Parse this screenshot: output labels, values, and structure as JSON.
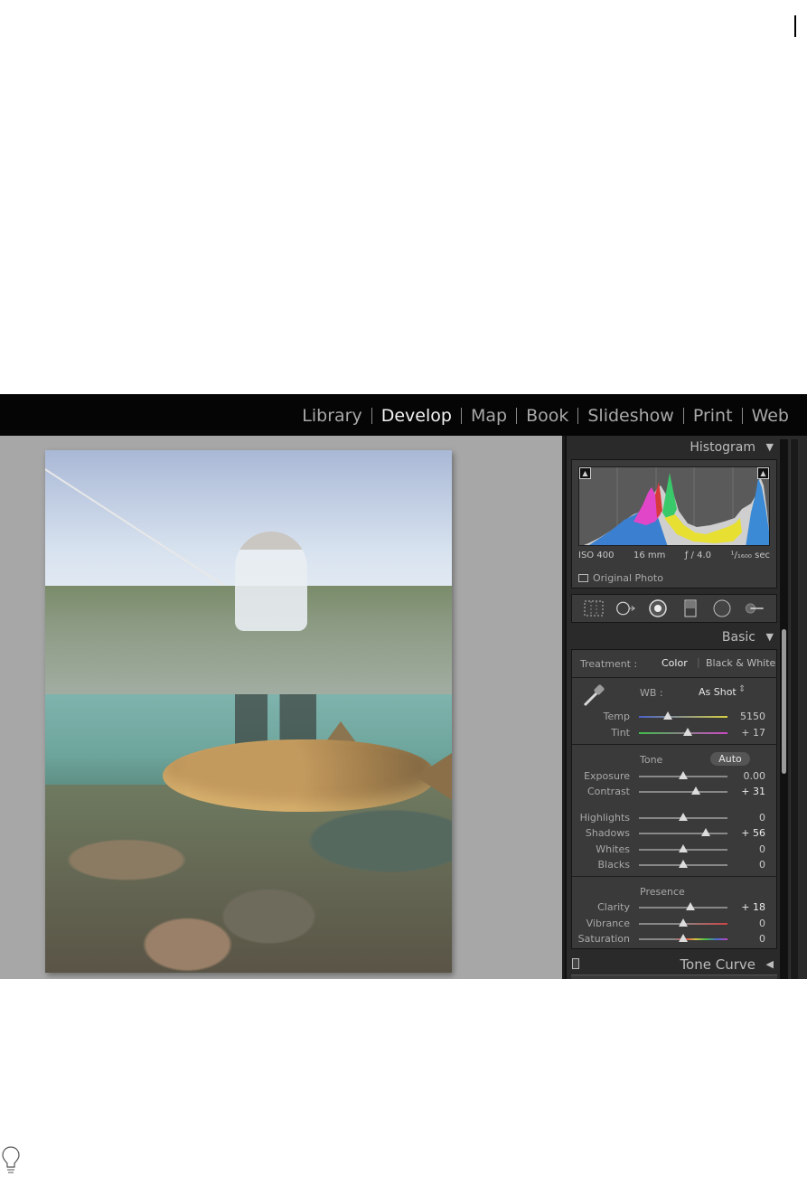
{
  "modules": [
    "Library",
    "Develop",
    "Map",
    "Book",
    "Slideshow",
    "Print",
    "Web"
  ],
  "active_module": "Develop",
  "histogram": {
    "title": "Histogram",
    "exif": {
      "iso": "ISO 400",
      "focal": "16 mm",
      "aperture": "ƒ / 4.0",
      "shutter": "¹/₁₆₀₀ sec"
    },
    "original_photo_label": "Original Photo"
  },
  "tools": [
    "crop-overlay-icon",
    "spot-removal-icon",
    "red-eye-icon",
    "graduated-filter-icon",
    "radial-filter-icon",
    "adjustment-brush-icon"
  ],
  "basic": {
    "title": "Basic",
    "treatment_label": "Treatment :",
    "treatment_color": "Color",
    "treatment_bw": "Black & White",
    "wb_label": "WB :",
    "wb_value": "As Shot",
    "tone_label": "Tone",
    "auto_label": "Auto",
    "presence_label": "Presence",
    "sliders": {
      "temp": {
        "label": "Temp",
        "value": "5150",
        "pos": 0.33
      },
      "tint": {
        "label": "Tint",
        "value": "+ 17",
        "pos": 0.55
      },
      "exposure": {
        "label": "Exposure",
        "value": "0.00",
        "pos": 0.5
      },
      "contrast": {
        "label": "Contrast",
        "value": "+ 31",
        "pos": 0.645
      },
      "highlights": {
        "label": "Highlights",
        "value": "0",
        "pos": 0.5
      },
      "shadows": {
        "label": "Shadows",
        "value": "+ 56",
        "pos": 0.76
      },
      "whites": {
        "label": "Whites",
        "value": "0",
        "pos": 0.5
      },
      "blacks": {
        "label": "Blacks",
        "value": "0",
        "pos": 0.5
      },
      "clarity": {
        "label": "Clarity",
        "value": "+ 18",
        "pos": 0.585
      },
      "vibrance": {
        "label": "Vibrance",
        "value": "0",
        "pos": 0.5
      },
      "saturation": {
        "label": "Saturation",
        "value": "0",
        "pos": 0.5
      }
    }
  },
  "tone_curve": {
    "title": "Tone Curve"
  },
  "colors": {
    "accent": "#f2f2f2",
    "panel": "#2a2a2a",
    "canvas": "#a7a7a7"
  }
}
